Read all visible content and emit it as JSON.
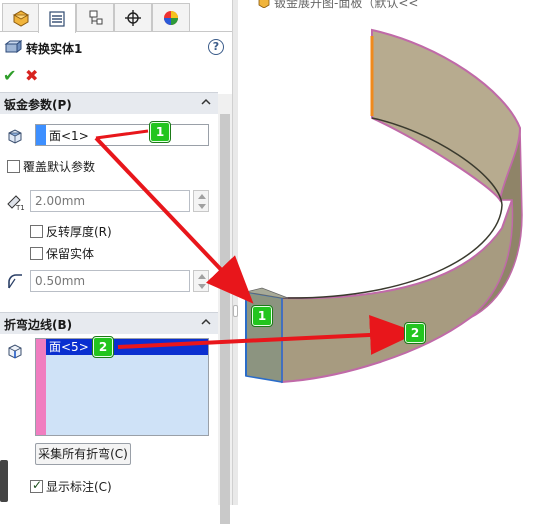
{
  "window": {
    "tree_hint": "钣金展开图-面板（默认<<"
  },
  "tabs": [
    {
      "name": "feature-manager"
    },
    {
      "name": "property-manager"
    },
    {
      "name": "configuration-manager"
    },
    {
      "name": "dimxpert-manager"
    },
    {
      "name": "display-manager"
    }
  ],
  "feature": {
    "title": "转换实体1",
    "help": "?"
  },
  "actions": {
    "ok": "✔",
    "cancel": "✖"
  },
  "sheet_metal": {
    "header": "钣金参数(P)",
    "face": "面<1>",
    "override_label": "覆盖默认参数",
    "thickness": "2.00mm",
    "reverse_label": "反转厚度(R)",
    "keep_body_label": "保留实体",
    "radius": "0.50mm"
  },
  "bend_edges": {
    "header": "折弯边线(B)",
    "selected": "面<5>",
    "collect_button": "采集所有折弯(C)",
    "show_callouts_label": "显示标注(C)",
    "show_callouts": true
  },
  "callouts": {
    "one": "1",
    "two": "2"
  },
  "colors": {
    "accent_blue": "#3d8fff",
    "edge_pink": "#f07dc0",
    "badge_green": "#22c51e",
    "arrow_red": "#e8161b",
    "part_tan": "#a79b80"
  }
}
